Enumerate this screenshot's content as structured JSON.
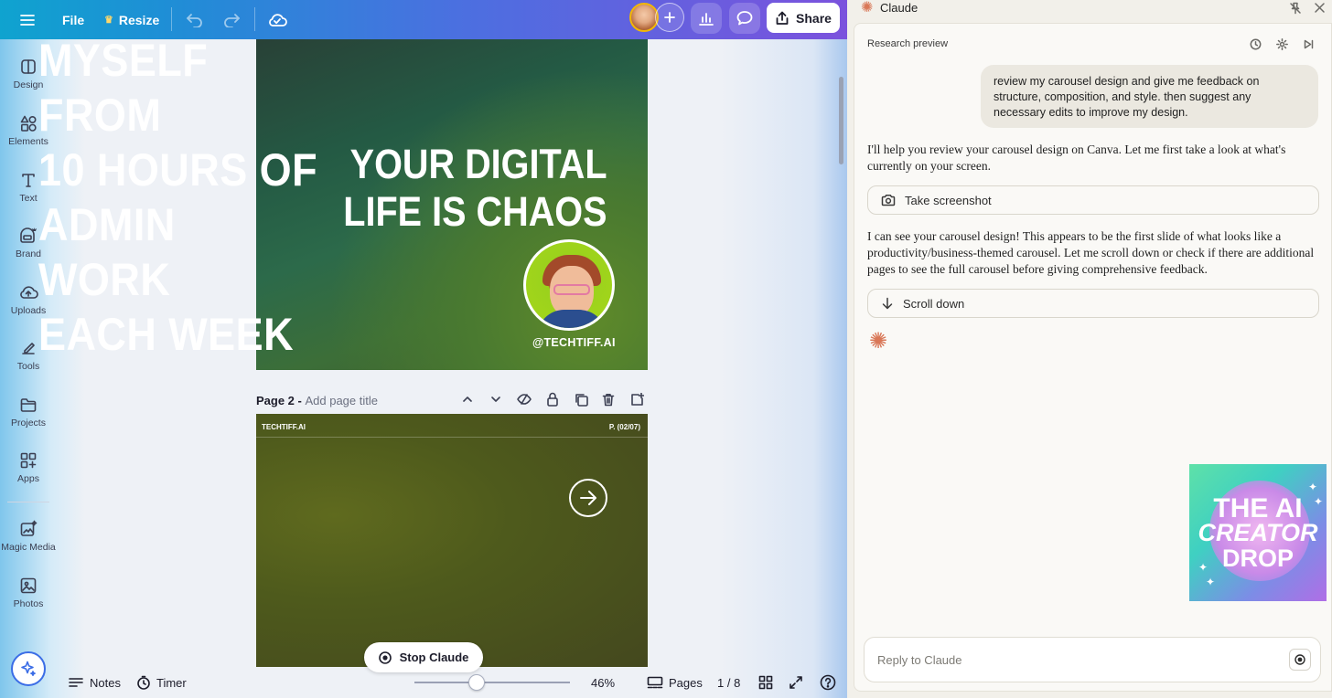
{
  "topbar": {
    "menu_label": "File",
    "resize_label": "Resize",
    "share_label": "Share"
  },
  "rail": {
    "items": [
      {
        "label": "Design",
        "icon": "design-icon"
      },
      {
        "label": "Elements",
        "icon": "elements-icon"
      },
      {
        "label": "Text",
        "icon": "text-icon"
      },
      {
        "label": "Brand",
        "icon": "brand-icon"
      },
      {
        "label": "Uploads",
        "icon": "uploads-icon"
      },
      {
        "label": "Tools",
        "icon": "tools-icon"
      },
      {
        "label": "Projects",
        "icon": "projects-icon"
      },
      {
        "label": "Apps",
        "icon": "apps-icon"
      },
      {
        "label": "Magic Media",
        "icon": "magic-media-icon"
      },
      {
        "label": "Photos",
        "icon": "photos-icon"
      }
    ]
  },
  "page1": {
    "headline": "MYSELF FROM\n10 HOURS OF\nADMIN WORK\nEACH WEEK",
    "handle": "@TECHTIFF.AI"
  },
  "page2": {
    "label": "Page 2 - ",
    "title_placeholder": "Add page title",
    "brand": "TECHTIFF.AI",
    "page_indicator": "P. (02/07)",
    "headline": "YOUR DIGITAL\nLIFE IS CHAOS"
  },
  "stop_claude_label": "Stop Claude",
  "bottombar": {
    "notes_label": "Notes",
    "timer_label": "Timer",
    "zoom_value": "46%",
    "zoom_fraction": 0.4,
    "pages_label": "Pages",
    "page_count": "1 / 8"
  },
  "claude": {
    "title": "Claude",
    "subtitle": "Research preview",
    "user_message": "review my carousel design and give me feedback on structure, composition, and style. then suggest any necessary edits to improve my design.",
    "assistant_1": "I'll help you review your carousel design on Canva. Let me first take a look at what's currently on your screen.",
    "tool_1": "Take screenshot",
    "assistant_2": "I can see your carousel design! This appears to be the first slide of what looks like a productivity/business-themed carousel. Let me scroll down or check if there are additional pages to see the full carousel before giving comprehensive feedback.",
    "tool_2": "Scroll down",
    "reply_placeholder": "Reply to Claude",
    "accent_color": "#d97757"
  },
  "promo": {
    "line1": "THE AI",
    "line2": "CREATOR",
    "line3": "DROP"
  }
}
